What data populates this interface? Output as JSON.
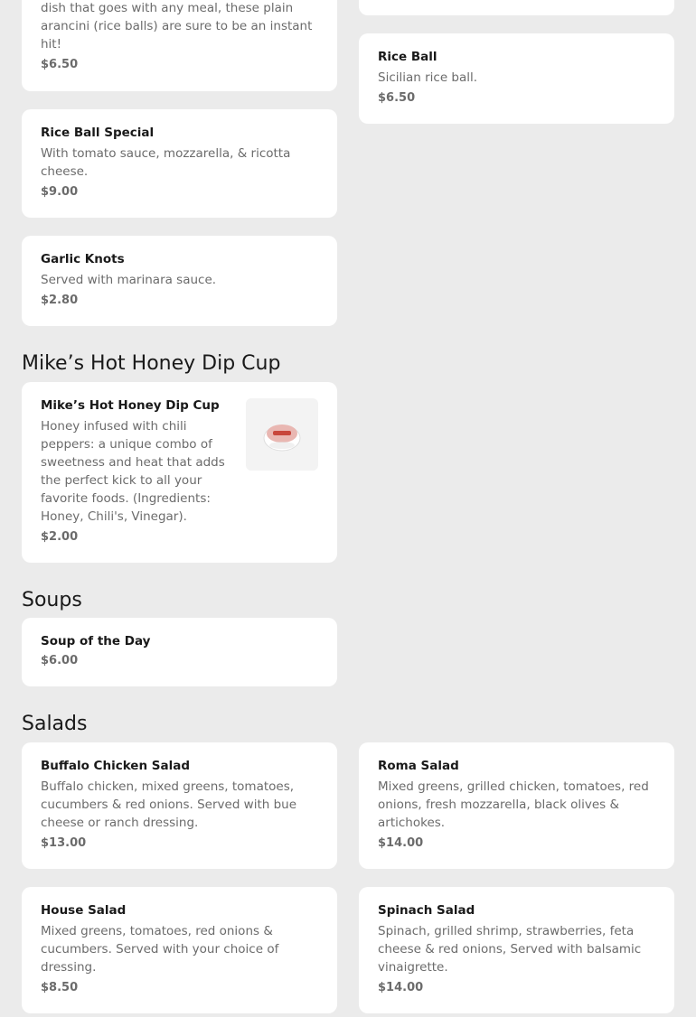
{
  "sections": {
    "honey_title": "Mike’s Hot Honey Dip Cup",
    "soups_title": "Soups",
    "salads_title": "Salads"
  },
  "items": {
    "plain_arancini": {
      "description": "dish that goes with any meal, these plain arancini (rice balls) are sure to be an instant hit!",
      "price": "$6.50"
    },
    "rice_ball": {
      "name": "Rice Ball",
      "description": "Sicilian rice ball.",
      "price": "$6.50"
    },
    "rice_ball_special": {
      "name": "Rice Ball Special",
      "description": "With tomato sauce, mozzarella, & ricotta cheese.",
      "price": "$9.00"
    },
    "garlic_knots": {
      "name": "Garlic Knots",
      "description": "Served with marinara sauce.",
      "price": "$2.80"
    },
    "hot_honey": {
      "name": "Mike’s Hot Honey Dip Cup",
      "description": "Honey infused with chili peppers: a unique combo of sweetness and heat that adds the perfect kick to all your favorite foods. (Ingredients: Honey, Chili's, Vinegar).",
      "price": "$2.00"
    },
    "soup_of_day": {
      "name": "Soup of the Day",
      "price": "$6.00"
    },
    "buffalo_salad": {
      "name": "Buffalo Chicken Salad",
      "description": "Buffalo chicken, mixed greens, tomatoes, cucumbers & red onions. Served with bue cheese or ranch dressing.",
      "price": "$13.00"
    },
    "roma_salad": {
      "name": "Roma Salad",
      "description": "Mixed greens, grilled chicken, tomatoes, red onions, fresh mozzarella, black olives & artichokes.",
      "price": "$14.00"
    },
    "house_salad": {
      "name": "House Salad",
      "description": "Mixed greens, tomatoes, red onions & cucumbers. Served with your choice of dressing.",
      "price": "$8.50"
    },
    "spinach_salad": {
      "name": "Spinach Salad",
      "description": "Spinach, grilled shrimp, strawberries, feta cheese & red onions, Served with balsamic vinaigrette.",
      "price": "$14.00"
    }
  }
}
